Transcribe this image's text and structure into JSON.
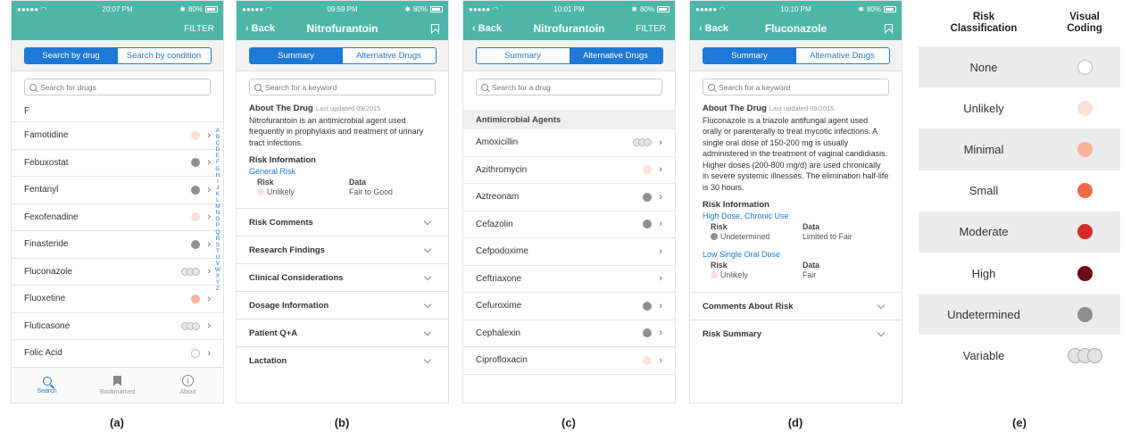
{
  "colors": {
    "teal": "#4db6a8",
    "blue": "#1e78d6",
    "none": "#ffffff",
    "unlikely": "#fbe1dc",
    "minimal": "#f7b49a",
    "small": "#ef6a4a",
    "moderate": "#d42a2a",
    "high": "#6b0d12",
    "undetermined": "#8f8f8f",
    "variable": "#e3e3e3"
  },
  "a": {
    "time": "20:07 PM",
    "battery": "80%",
    "nav_right": "FILTER",
    "seg": [
      "Search by drug",
      "Search by condition"
    ],
    "search_placeholder": "Search for drugs",
    "section_letter": "F",
    "rows": [
      {
        "name": "Famotidine",
        "risk": "unlikely"
      },
      {
        "name": "Febuxostat",
        "risk": "undetermined"
      },
      {
        "name": "Fentanyl",
        "risk": "undetermined"
      },
      {
        "name": "Fexofenadine",
        "risk": "unlikely"
      },
      {
        "name": "Finasteride",
        "risk": "undetermined"
      },
      {
        "name": "Fluconazole",
        "risk": "variable"
      },
      {
        "name": "Fluoxetine",
        "risk": "minimal"
      },
      {
        "name": "Fluticasone",
        "risk": "variable"
      },
      {
        "name": "Folic Acid",
        "risk": "none"
      }
    ],
    "alphabet": [
      "A",
      "B",
      "C",
      "D",
      "E",
      "F",
      "G",
      "H",
      "I",
      "J",
      "K",
      "L",
      "M",
      "N",
      "O",
      "P",
      "Q",
      "R",
      "S",
      "T",
      "U",
      "V",
      "W",
      "X",
      "Y",
      "Z"
    ],
    "tabs": [
      "Search",
      "Bookmarked",
      "About"
    ],
    "info_glyph": "i"
  },
  "b": {
    "time": "09:59 PM",
    "battery": "80%",
    "back": "Back",
    "title": "Nitrofurantoin",
    "seg": [
      "Summary",
      "Alternative Drugs"
    ],
    "search_placeholder": "Search for a keyword",
    "about_head": "About The Drug",
    "about_updated": "Last updated 09/2015",
    "about_text": "Nitrofurantoin is an antimicrobial agent used frequently in prophylaxis and treatment of urinary tract infections.",
    "risk_title": "Risk Information",
    "risk_link": "General Risk",
    "risk_h": "Risk",
    "data_h": "Data",
    "risk_v": "Unlikely",
    "data_v": "Fair to Good",
    "accordions": [
      "Risk Comments",
      "Research Findings",
      "Clinical Considerations",
      "Dosage Information",
      "Patient Q+A",
      "Lactation"
    ]
  },
  "c": {
    "time": "10:01 PM",
    "battery": "80%",
    "back": "Back",
    "title": "Nitrofurantoin",
    "nav_right": "FILTER",
    "seg": [
      "Summary",
      "Alternative Drugs"
    ],
    "search_placeholder": "Search for a drug",
    "section": "Antimicrobial Agents",
    "rows": [
      {
        "name": "Amoxicillin",
        "risk": "variable"
      },
      {
        "name": "Azithromycin",
        "risk": "unlikely"
      },
      {
        "name": "Aztreonam",
        "risk": "undetermined"
      },
      {
        "name": "Cefazolin",
        "risk": "undetermined"
      },
      {
        "name": "Cefpodoxime",
        "risk": ""
      },
      {
        "name": "Ceftriaxone",
        "risk": ""
      },
      {
        "name": "Cefuroxime",
        "risk": "undetermined"
      },
      {
        "name": "Cephalexin",
        "risk": "undetermined"
      },
      {
        "name": "Ciprofloxacin",
        "risk": "unlikely"
      }
    ]
  },
  "d": {
    "time": "10:10 PM",
    "battery": "80%",
    "back": "Back",
    "title": "Fluconazole",
    "seg": [
      "Summary",
      "Alternative Drugs"
    ],
    "search_placeholder": "Search for a keyword",
    "about_head": "About The Drug",
    "about_updated": "Last updated 09/2015",
    "about_text": "Fluconazole is a triazole antifungal agent used orally or parenterally to treat mycotic infections. A single oral dose of 150-200 mg is usually administered in the treatment of vaginal candidiasis. Higher doses (200-800 mg/d) are used chronically in severe systemic illnesses. The elimination half-life is 30 hours.",
    "risk_title": "Risk Information",
    "groups": [
      {
        "link": "High Dose, Chronic Use",
        "risk_h": "Risk",
        "data_h": "Data",
        "risk_v": "Undetermined",
        "data_v": "Limited to Fair",
        "risk": "undetermined"
      },
      {
        "link": "Low Single Oral Dose",
        "risk_h": "Risk",
        "data_h": "Data",
        "risk_v": "Unlikely",
        "data_v": "Fair",
        "risk": "unlikely"
      }
    ],
    "accordions": [
      "Comments About Risk",
      "Risk Summary"
    ]
  },
  "e": {
    "head": [
      "Risk\nClassification",
      "Visual\nCoding"
    ],
    "rows": [
      {
        "label": "None",
        "risk": "none"
      },
      {
        "label": "Unlikely",
        "risk": "unlikely"
      },
      {
        "label": "Minimal",
        "risk": "minimal"
      },
      {
        "label": "Small",
        "risk": "small"
      },
      {
        "label": "Moderate",
        "risk": "moderate"
      },
      {
        "label": "High",
        "risk": "high"
      },
      {
        "label": "Undetermined",
        "risk": "undetermined"
      },
      {
        "label": "Variable",
        "risk": "variable"
      }
    ]
  },
  "captions": [
    "(a)",
    "(b)",
    "(c)",
    "(d)",
    "(e)"
  ]
}
